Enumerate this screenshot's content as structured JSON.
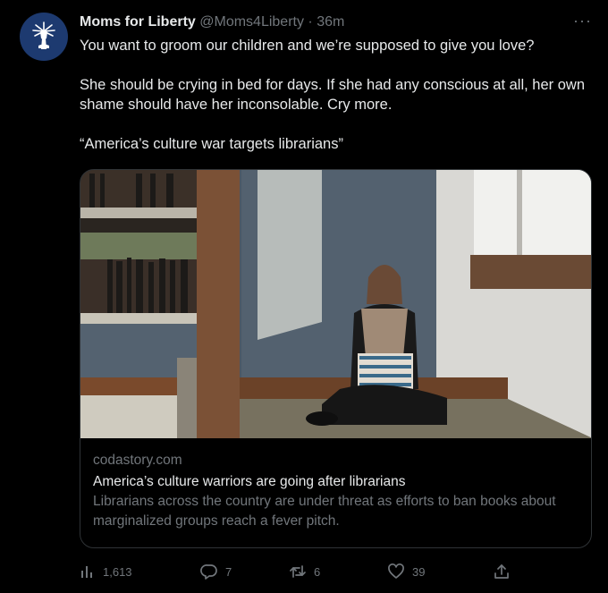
{
  "tweet": {
    "display_name": "Moms for Liberty",
    "handle": "@Moms4Liberty",
    "separator": "·",
    "time": "36m",
    "more_icon": "more-horizontal-icon",
    "avatar_icon": "liberty-torch-logo",
    "text_paragraphs": [
      "You want to groom our children and we’re supposed to give you love?",
      "She should be crying in bed for days. If she had any conscious at all, her own shame should have her inconsolable. Cry more.",
      "“America’s culture war targets librarians”"
    ]
  },
  "card": {
    "domain": "codastory.com",
    "title": "America’s culture warriors are going after librarians",
    "description": "Librarians across the country are under threat as efforts to ban books about marginalized groups reach a fever pitch."
  },
  "actions": {
    "views": {
      "icon": "analytics-icon",
      "count": "1,613"
    },
    "reply": {
      "icon": "reply-icon",
      "count": "7"
    },
    "retweet": {
      "icon": "retweet-icon",
      "count": "6"
    },
    "like": {
      "icon": "heart-icon",
      "count": "39"
    },
    "share": {
      "icon": "share-icon"
    }
  },
  "colors": {
    "background": "#000000",
    "text": "#e7e9ea",
    "muted": "#71767b",
    "border": "#2f3336",
    "avatar_bg": "#1d3a70"
  }
}
